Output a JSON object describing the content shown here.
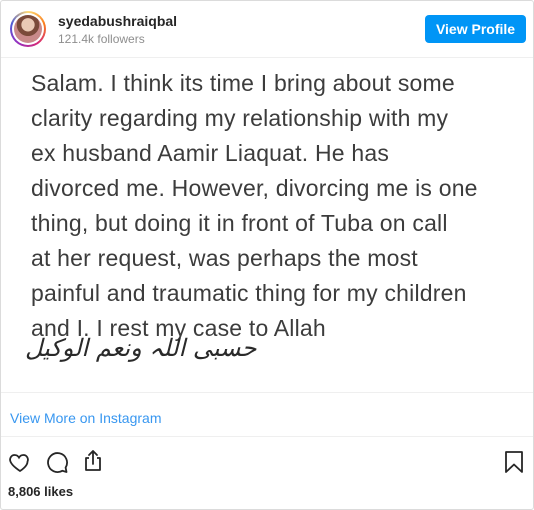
{
  "header": {
    "username": "syedabushraiqbal",
    "followers": "121.4k followers",
    "view_profile_label": "View Profile"
  },
  "post": {
    "lines": [
      "Salam. I think its time I bring about some",
      "clarity regarding my relationship with my",
      "ex husband Aamir Liaquat. He has",
      "divorced me. However, divorcing me is one",
      "thing, but doing it in front of Tuba on call",
      "at her request, was perhaps the most",
      "painful and traumatic thing for my children",
      "and I. I rest my case to Allah"
    ],
    "urdu": "حسبی اللہ ونعم الوکیل"
  },
  "view_more_label": "View More on Instagram",
  "actions": {
    "icons": [
      "heart-icon",
      "comment-icon",
      "share-icon",
      "bookmark-icon"
    ]
  },
  "likes": "8,806 likes",
  "colors": {
    "accent": "#0095f6",
    "link": "#3897f0",
    "text": "#262626",
    "muted": "#8e8e8e"
  }
}
